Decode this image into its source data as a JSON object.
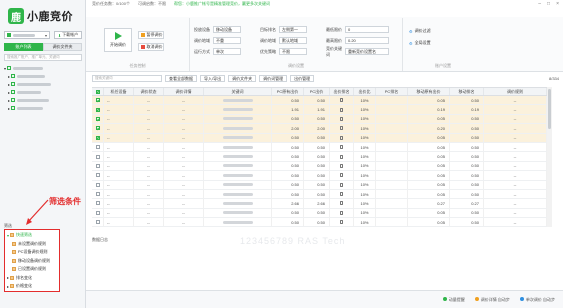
{
  "app": {
    "name": "小鹿竞价",
    "logo_char": "鹿"
  },
  "topbar": {
    "task": "竞价任务数：0/100个",
    "status": "可调启数：不限",
    "tip": "帮您：小鹿推广帐号是精准管理竞价，赢更多次关键词",
    "window_controls": [
      "–",
      "□",
      "×"
    ]
  },
  "left": {
    "account_selector": "",
    "download_button": "下载帐户",
    "tabs": [
      "账户列表",
      "调价文件夹"
    ],
    "search_placeholder": "搜索推广账户、推广单元、关键词",
    "filter_label": "筛选",
    "annotation": "筛选条件",
    "filter_items": [
      {
        "label": "快速筛选",
        "type": "head"
      },
      {
        "label": "未设置调价规则",
        "type": "sub"
      },
      {
        "label": "PC设备调价规则",
        "type": "sub"
      },
      {
        "label": "移动设备调价规则",
        "type": "sub"
      },
      {
        "label": "已设置调价规则",
        "type": "sub"
      },
      {
        "label": "排名变化",
        "type": "item"
      },
      {
        "label": "价格变化",
        "type": "item"
      }
    ]
  },
  "ribbon": {
    "start_button": "开始调价",
    "pause_button": "暂停调价",
    "cancel_button": "取消调价",
    "group1_label": "任务控制",
    "fields_a": [
      {
        "label": "投放设备",
        "value": "移动设备"
      },
      {
        "label": "调价地域",
        "value": "不重"
      },
      {
        "label": "运行方式",
        "value": "单次"
      }
    ],
    "fields_b": [
      {
        "label": "目标排名",
        "value": "左侧第一"
      },
      {
        "label": "调价地域",
        "value": "默认地域"
      },
      {
        "label": "优先策略",
        "value": "不限"
      }
    ],
    "fields_c": [
      {
        "label": "最低限价",
        "value": "0"
      },
      {
        "label": "最高限价",
        "value": "0.20"
      },
      {
        "label": "竞价关键词",
        "value": "重新竞价设置名"
      }
    ],
    "group2_label": "调价设置",
    "tools": [
      "调价过滤",
      "全局设置"
    ],
    "group3_label": "账户设置"
  },
  "grid": {
    "search_placeholder": "搜索关键词",
    "buttons": [
      "查看全部数据",
      "导入/导出",
      "调价文件夹",
      "调价词管理",
      "出价管理"
    ],
    "total": "8/334",
    "columns": [
      "",
      "机任设备",
      "调价状态",
      "调价详情",
      "关键词",
      "PC原有出价",
      "PC出价",
      "出价排名",
      "出价比",
      "PC排名",
      "移动原有出价",
      "移动排名",
      "调价规则"
    ],
    "rows": [
      {
        "checked": true,
        "pc_orig": "0.50",
        "pc_bid": "0.50",
        "ratio": "10%",
        "m_orig": "0.05",
        "m_rank": "0.50"
      },
      {
        "checked": true,
        "pc_orig": "1.91",
        "pc_bid": "1.91",
        "ratio": "10%",
        "m_orig": "0.19",
        "m_rank": "0.19"
      },
      {
        "checked": true,
        "pc_orig": "0.50",
        "pc_bid": "0.50",
        "ratio": "10%",
        "m_orig": "0.05",
        "m_rank": "0.50"
      },
      {
        "checked": true,
        "pc_orig": "2.00",
        "pc_bid": "2.00",
        "ratio": "10%",
        "m_orig": "0.20",
        "m_rank": "0.50"
      },
      {
        "checked": true,
        "pc_orig": "0.50",
        "pc_bid": "0.50",
        "ratio": "10%",
        "m_orig": "0.05",
        "m_rank": "0.50"
      },
      {
        "checked": false,
        "pc_orig": "0.50",
        "pc_bid": "0.50",
        "ratio": "10%",
        "m_orig": "0.05",
        "m_rank": "0.50"
      },
      {
        "checked": false,
        "pc_orig": "0.50",
        "pc_bid": "0.50",
        "ratio": "10%",
        "m_orig": "0.05",
        "m_rank": "0.50"
      },
      {
        "checked": false,
        "pc_orig": "0.50",
        "pc_bid": "0.50",
        "ratio": "10%",
        "m_orig": "0.05",
        "m_rank": "0.50"
      },
      {
        "checked": false,
        "pc_orig": "0.50",
        "pc_bid": "0.50",
        "ratio": "10%",
        "m_orig": "0.05",
        "m_rank": "0.50"
      },
      {
        "checked": false,
        "pc_orig": "0.50",
        "pc_bid": "0.50",
        "ratio": "10%",
        "m_orig": "0.05",
        "m_rank": "0.50"
      },
      {
        "checked": false,
        "pc_orig": "0.50",
        "pc_bid": "0.50",
        "ratio": "10%",
        "m_orig": "0.05",
        "m_rank": "0.50"
      },
      {
        "checked": false,
        "pc_orig": "2.66",
        "pc_bid": "2.66",
        "ratio": "10%",
        "m_orig": "0.27",
        "m_rank": "0.27"
      },
      {
        "checked": false,
        "pc_orig": "0.50",
        "pc_bid": "0.50",
        "ratio": "10%",
        "m_orig": "0.05",
        "m_rank": "0.50"
      },
      {
        "checked": false,
        "pc_orig": "0.50",
        "pc_bid": "0.50",
        "ratio": "10%",
        "m_orig": "0.05",
        "m_rank": "0.50"
      }
    ],
    "dash": "--"
  },
  "log_note": "数据日志",
  "watermark": "123456789 RAS Tech",
  "status": {
    "items": [
      "动量提醒",
      "调价详情 自动步",
      "单次调价 自动步"
    ],
    "colors": [
      "#2fb54a",
      "#f0a020",
      "#2f8fe0"
    ]
  },
  "colors": {
    "brand": "#2fb54a",
    "selected_row": "#fbf1dc",
    "annotation": "#e32d2d"
  }
}
